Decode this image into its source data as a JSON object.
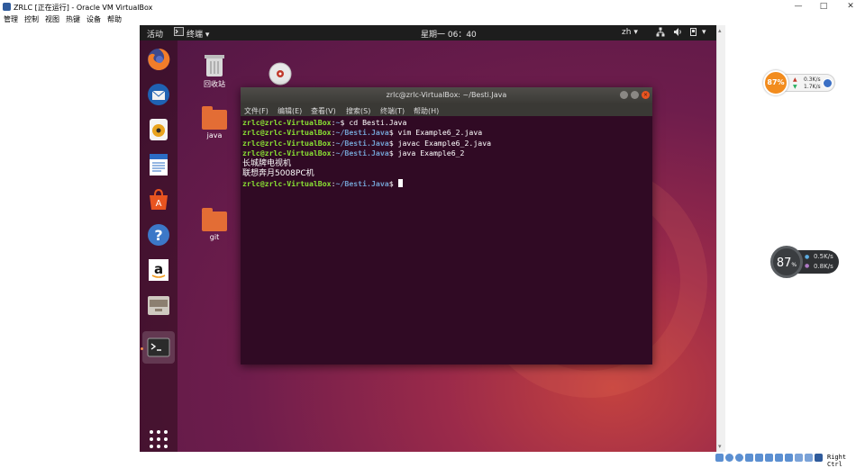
{
  "window": {
    "title": "ZRLC [正在运行] - Oracle VM VirtualBox",
    "menu": [
      "管理",
      "控制",
      "视图",
      "热键",
      "设备",
      "帮助"
    ],
    "minimize": "—",
    "maximize": "□",
    "close": "✕"
  },
  "ubuntu_topbar": {
    "activities": "活动",
    "app_menu": "终端",
    "clock": "星期一 06：40",
    "input_method": "zh"
  },
  "desktop": {
    "icons": [
      {
        "label": "回收站",
        "icon": "trash-icon"
      },
      {
        "label": "java",
        "icon": "folder-icon"
      },
      {
        "label": "git",
        "icon": "folder-icon"
      }
    ]
  },
  "dock": {
    "items": [
      "firefox-icon",
      "thunderbird-icon",
      "rhythmbox-icon",
      "libreoffice-writer-icon",
      "ubuntu-software-icon",
      "help-icon",
      "amazon-icon",
      "files-icon",
      "terminal-icon",
      "show-applications-icon"
    ]
  },
  "terminal": {
    "title": "zrlc@zrlc-VirtualBox: ~/Besti.Java",
    "menu": [
      "文件(F)",
      "编辑(E)",
      "查看(V)",
      "搜索(S)",
      "终端(T)",
      "帮助(H)"
    ],
    "lines": [
      {
        "user": "zrlc@zrlc-VirtualBox",
        "path": "~",
        "cmd": "cd Besti.Java"
      },
      {
        "user": "zrlc@zrlc-VirtualBox",
        "path": "~/Besti.Java",
        "cmd": "vim Example6_2.java"
      },
      {
        "user": "zrlc@zrlc-VirtualBox",
        "path": "~/Besti.Java",
        "cmd": "javac Example6_2.java"
      },
      {
        "user": "zrlc@zrlc-VirtualBox",
        "path": "~/Besti.Java",
        "cmd": "java Example6_2"
      }
    ],
    "output": [
      "长城牌电视机",
      "联想奔月5008PC机"
    ],
    "final_prompt": {
      "user": "zrlc@zrlc-VirtualBox",
      "path": "~/Besti.Java"
    }
  },
  "gadgets": {
    "top": {
      "percent": "87%",
      "up": "0.3K/s",
      "down": "1.7K/s"
    },
    "bottom": {
      "percent": "87",
      "percent_sign": "%",
      "up": "0.5K/s",
      "down": "0.8K/s"
    }
  },
  "statusbar": {
    "host_key": "Right Ctrl"
  },
  "colors": {
    "prompt_user": "#8ae234",
    "prompt_path": "#729fcf",
    "terminal_bg": "#300a24",
    "ubuntu_orange": "#e95420"
  }
}
